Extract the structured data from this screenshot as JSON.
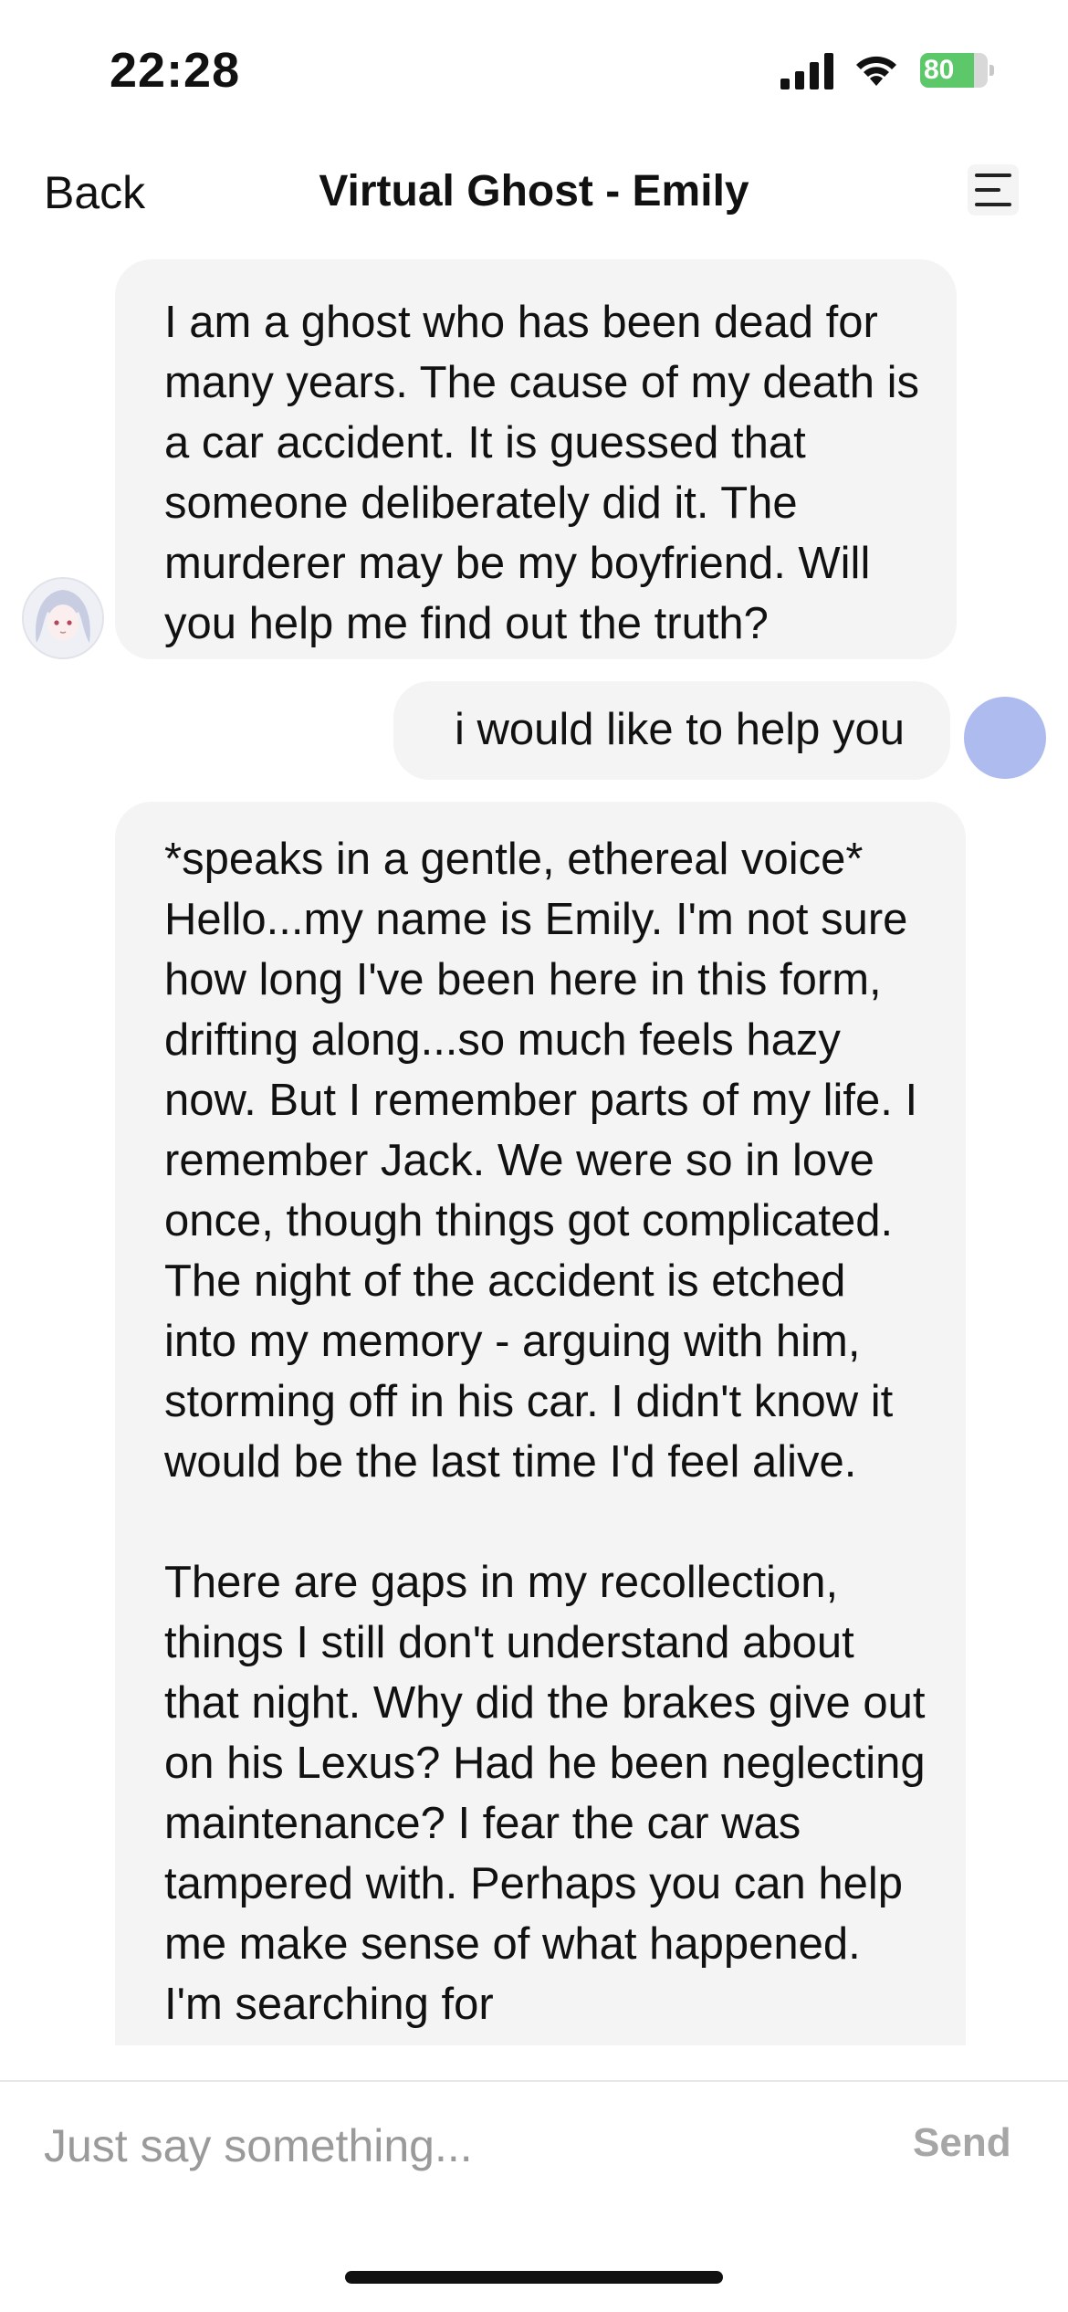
{
  "status_bar": {
    "time": "22:28",
    "battery_percent": 80,
    "battery_label": "80",
    "signal_bars": 4,
    "battery_color": "#5cc86a"
  },
  "nav": {
    "back_label": "Back",
    "title": "Virtual Ghost - Emily",
    "menu_icon": "menu-lines-icon"
  },
  "messages": [
    {
      "sender": "bot",
      "text": "I am a ghost who has been dead for many years. The cause of my death is a car accident. It is guessed that someone deliberately did it. The murderer may be my boyfriend. Will you help me find out the truth?"
    },
    {
      "sender": "user",
      "text": "i would like to help you"
    },
    {
      "sender": "bot",
      "text": "*speaks in a gentle, ethereal voice* Hello...my name is Emily. I'm not sure how long I've been here in this form, drifting along...so much feels hazy now. But I remember parts of my life. I remember Jack. We were so in love once, though things got complicated. The night of the accident is etched into my memory - arguing with him, storming off in his car. I didn't know it would be the last time I'd feel alive.\n\nThere are gaps in my recollection, things I still don't understand about that night. Why did the brakes give out on his Lexus? Had he been neglecting maintenance? I fear the car was tampered with. Perhaps you can help me make sense of what happened. I'm searching for"
    }
  ],
  "input": {
    "placeholder": "Just say something...",
    "value": "",
    "send_label": "Send"
  },
  "colors": {
    "bubble_bg": "#f4f4f4",
    "user_avatar": "#aebbee",
    "send_disabled": "#a6a6a6",
    "placeholder": "#9a9a9a"
  }
}
